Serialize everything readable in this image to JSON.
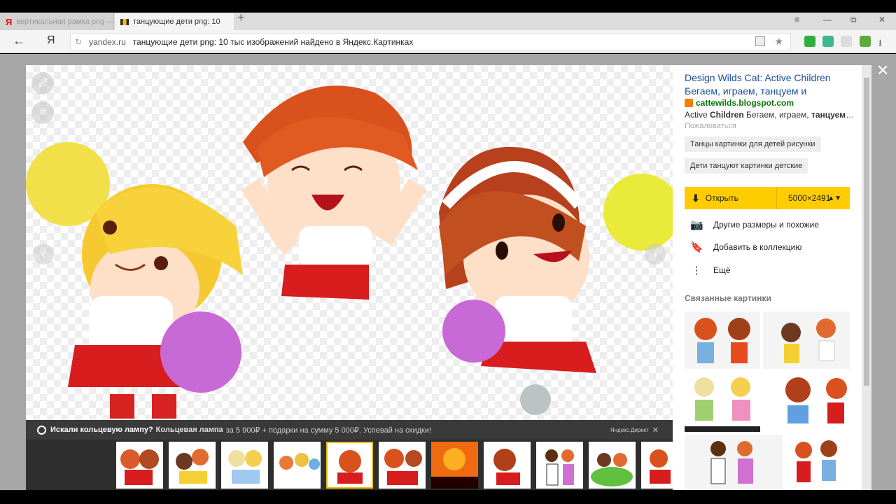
{
  "browser": {
    "tabs": [
      {
        "label": "вертикальная рамка png —"
      },
      {
        "label": "танцующие дети png: 10"
      }
    ],
    "new_tab": "+",
    "window_controls": [
      "≡",
      "—",
      "⧉",
      "✕"
    ],
    "back": "←",
    "yandex_button": "Я",
    "url_domain": "yandex.ru",
    "url_title": "танцующие дети png: 10 тыс изображений найдено в Яндекс.Картинках"
  },
  "viewer": {
    "prev": "‹",
    "next": "›",
    "close": "✕"
  },
  "ad": {
    "question": "Искали кольцевую лампу?",
    "product": "Кольцевая лампа",
    "text": "за 5 900₽ + подарки на сумму 5 000₽. Успевай на скидки!",
    "direct": "Яндекс.Директ",
    "close": "✕"
  },
  "panel": {
    "title": "Design Wilds Cat: Active Children Бегаем, играем, танцуем и",
    "source": "cattewilds.blogspot.com",
    "desc_pre": "Active ",
    "desc_b1": "Children",
    "desc_mid": " Бегаем, играем, ",
    "desc_b2": "танцуем",
    "desc_post": "…",
    "complain": "Пожаловаться",
    "tags": [
      "Танцы картинки для детей рисунки",
      "Дети танцуют картинки детские"
    ],
    "open_label": "Открыть",
    "size": "5000×2491",
    "actions": [
      {
        "icon": "camera-icon",
        "label": "Другие размеры и похожие"
      },
      {
        "icon": "bookmark-icon",
        "label": "Добавить в коллекцию"
      },
      {
        "icon": "more-icon",
        "label": "Ещё"
      }
    ],
    "related_heading": "Связанные картинки"
  },
  "colors": {
    "accent": "#ffcc00",
    "link": "#1a4fa0",
    "source": "#007700"
  }
}
